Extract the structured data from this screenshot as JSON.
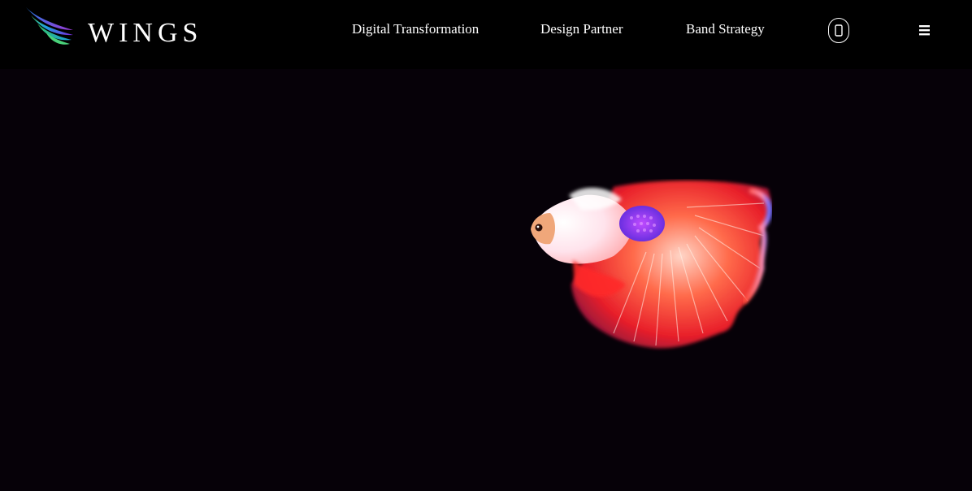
{
  "brand": {
    "name": "WINGS",
    "logo_icon": "wings-logo-icon"
  },
  "nav": {
    "items": [
      {
        "label": "Digital Transformation"
      },
      {
        "label": "Design Partner"
      },
      {
        "label": "Band Strategy"
      }
    ],
    "phone_icon": "phone-icon",
    "menu_icon": "hamburger-menu-icon"
  },
  "hero": {
    "image": "betta-fish-image"
  },
  "colors": {
    "header_bg": "#000000",
    "hero_bg": "#060108",
    "text": "#ffffff"
  }
}
